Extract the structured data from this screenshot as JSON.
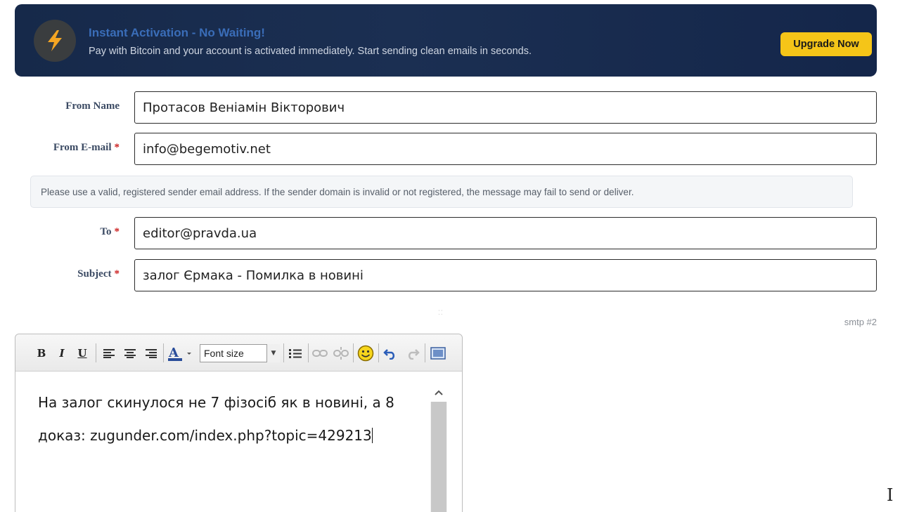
{
  "banner": {
    "title": "Instant Activation - No Waiting!",
    "description": "Pay with Bitcoin and your account is activated immediately. Start sending clean emails in seconds.",
    "upgrade_label": "Upgrade Now",
    "icon": "lightning-bolt-icon"
  },
  "form": {
    "from_name": {
      "label": "From Name",
      "value": "Протасов Веніамін Вікторович"
    },
    "from_email": {
      "label": "From E-mail",
      "required_mark": "*",
      "value": "info@begemotiv.net"
    },
    "notice": "Please use a valid, registered sender email address. If the sender domain is invalid or not registered, the message may fail to send or deliver.",
    "to": {
      "label": "To",
      "required_mark": "*",
      "value": "editor@pravda.ua"
    },
    "subject": {
      "label": "Subject",
      "required_mark": "*",
      "value": "залог Єрмака - Помилка в новині"
    },
    "smtp_label": "smtp #2"
  },
  "editor": {
    "toolbar": {
      "bold": "B",
      "italic": "I",
      "underline": "U",
      "font_size_label": "Font size"
    },
    "content": {
      "paragraph1": "На залог скинулося не 7 фізосіб як в новині, а 8",
      "paragraph2": "доказ: zugunder.com/index.php?topic=429213"
    }
  },
  "colors": {
    "banner_bg": "#16294a",
    "banner_title": "#3a6db8",
    "upgrade_button": "#f5c518",
    "required": "#cc2222",
    "label": "#3b4a63"
  }
}
